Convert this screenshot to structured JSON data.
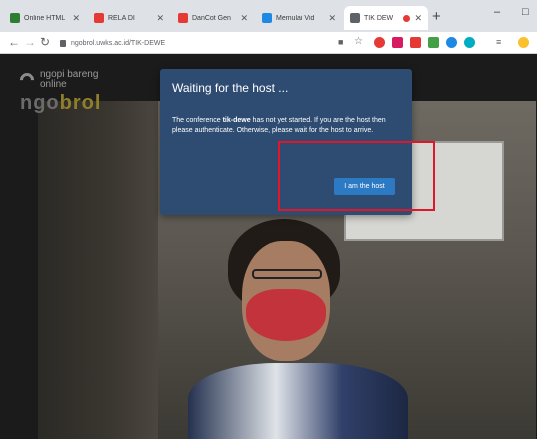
{
  "browser": {
    "tabs": [
      {
        "title": "Online HTML",
        "favicon_color": "#2e7d32"
      },
      {
        "title": "RELA DI",
        "favicon_color": "#e53935"
      },
      {
        "title": "DanCot Gen",
        "favicon_color": "#e53935"
      },
      {
        "title": "Memulai Vid",
        "favicon_color": "#1e88e5"
      },
      {
        "title": "TIK DEW",
        "favicon_color": "#5f6368",
        "active": true,
        "recording": true
      }
    ],
    "new_tab_label": "+",
    "minimize_label": "–",
    "maximize_label": "□",
    "address": "ngobrol.uwks.ac.id/TIK-DEWE",
    "extension_colors": [
      "#e53935",
      "#d81b60",
      "#e53935",
      "#43a047",
      "#1e88e5",
      "#00acc1",
      "#fbc02d"
    ]
  },
  "app": {
    "logo_line1": "ngopi  bareng",
    "logo_line2": "online",
    "logo_main_a": "ngo",
    "logo_main_b": "brol"
  },
  "dialog": {
    "title": "Waiting for the host ...",
    "body_before": "The conference ",
    "conference_name": "tik-dewe",
    "body_after": " has not yet started. If you are the host then please authenticate. Otherwise, please wait for the host to arrive.",
    "host_button_label": "I am the host"
  },
  "annotation": {
    "highlight_color": "#e0162b"
  }
}
